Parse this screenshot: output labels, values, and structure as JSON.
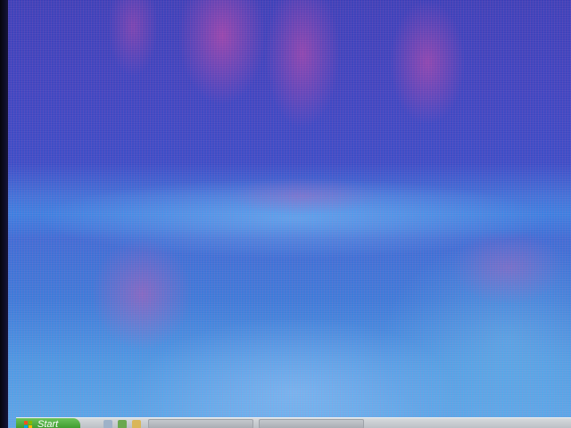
{
  "taskbar": {
    "start_label": "Start",
    "quick_launch": [
      {
        "icon": "browser-icon",
        "color": "#9fb2c8"
      },
      {
        "icon": "media-icon",
        "color": "#6aa84f"
      },
      {
        "icon": "folder-icon",
        "color": "#d9b65a"
      }
    ]
  },
  "colors": {
    "wallpaper_top": "#3b3fb8",
    "wallpaper_horizon": "#3b7fe0",
    "wallpaper_bottom": "#5aa8e8",
    "moire": "#ff5aaa",
    "taskbar": "#c9cdd2",
    "start_button": "#4aab38"
  }
}
